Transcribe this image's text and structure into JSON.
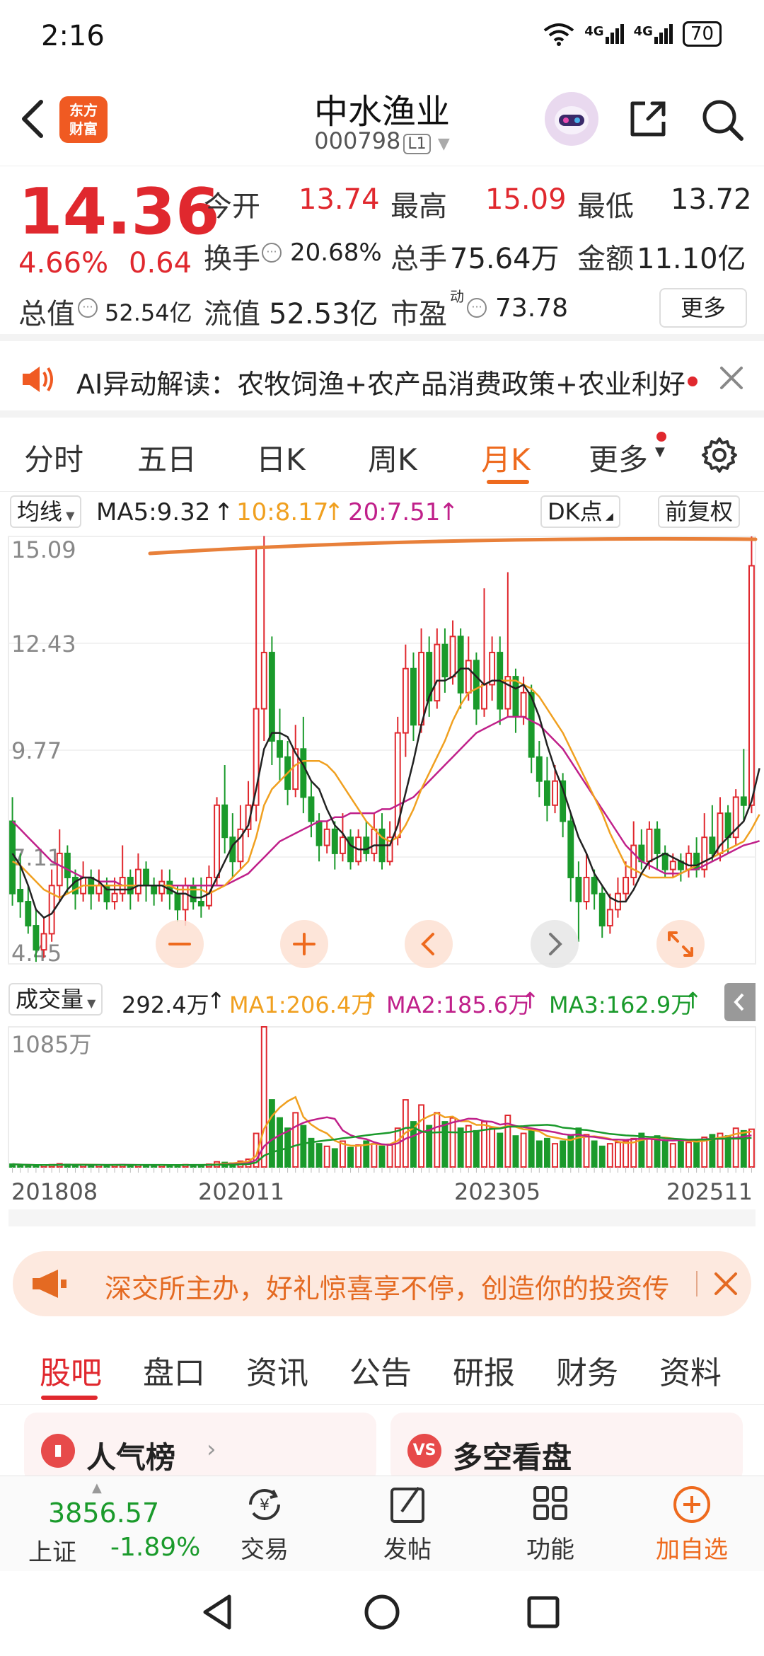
{
  "status_bar": {
    "time": "2:16",
    "network_1": "4G",
    "network_2": "4G",
    "battery": "70"
  },
  "header": {
    "name": "中水渔业",
    "code": "000798",
    "level_tag": "L1",
    "logo_text_1": "东方",
    "logo_text_2": "财富"
  },
  "quote": {
    "price": "14.36",
    "change_pct": "4.66%",
    "change_val": "0.64",
    "open_label": "今开",
    "open": "13.74",
    "high_label": "最高",
    "high": "15.09",
    "low_label": "最低",
    "low": "13.72",
    "turnover_label": "换手",
    "turnover": "20.68%",
    "volume_label": "总手",
    "volume": "75.64万",
    "amount_label": "金额",
    "amount": "11.10亿",
    "mktcap_label": "总值",
    "mktcap": "52.54亿",
    "float_label": "流值",
    "float_cap": "52.53亿",
    "pe_label": "市盈",
    "pe_sup": "动",
    "pe": "73.78",
    "more_button": "更多"
  },
  "ai_bar": {
    "text": "AI异动解读：农牧饲渔+农产品消费政策+农业利好"
  },
  "tabs": [
    "分时",
    "五日",
    "日K",
    "周K",
    "月K",
    "更多"
  ],
  "active_tab": "月K",
  "ma": {
    "selector": "均线",
    "ma5": "MA5:9.32",
    "ma10": "10:8.17",
    "ma20": "20:7.51",
    "dk_button": "DK点",
    "adjust_button": "前复权"
  },
  "chart_data": {
    "type": "candlestick",
    "period": "monthly",
    "y_ticks": [
      "15.09",
      "12.43",
      "9.77",
      "7.11",
      "4.45"
    ],
    "ylim": [
      4.45,
      15.09
    ],
    "x_labels": [
      "201808",
      "202011",
      "202305",
      "202511"
    ],
    "colors": {
      "up": "#e0282e",
      "down": "#1a9a2b",
      "ma5": "#222222",
      "ma10": "#f0a020",
      "ma20": "#c0208a"
    },
    "candles": [
      [
        8.0,
        6.2,
        8.6,
        5.9
      ],
      [
        6.3,
        6.0,
        7.2,
        5.6
      ],
      [
        6.0,
        5.4,
        6.4,
        5.2
      ],
      [
        5.4,
        4.8,
        5.8,
        4.5
      ],
      [
        4.8,
        5.2,
        5.6,
        4.6
      ],
      [
        5.2,
        6.4,
        6.8,
        5.0
      ],
      [
        6.4,
        7.2,
        7.8,
        6.0
      ],
      [
        7.2,
        6.6,
        7.4,
        6.2
      ],
      [
        6.6,
        6.2,
        6.8,
        5.8
      ],
      [
        6.2,
        6.6,
        7.0,
        6.0
      ],
      [
        6.6,
        6.2,
        6.8,
        5.8
      ],
      [
        6.2,
        6.4,
        6.8,
        6.0
      ],
      [
        6.4,
        6.0,
        6.6,
        5.8
      ],
      [
        6.0,
        6.2,
        6.6,
        5.8
      ],
      [
        6.2,
        6.6,
        7.4,
        6.0
      ],
      [
        6.6,
        6.2,
        6.8,
        5.8
      ],
      [
        6.2,
        6.8,
        7.2,
        6.0
      ],
      [
        6.8,
        6.4,
        7.0,
        6.0
      ],
      [
        6.4,
        6.2,
        6.6,
        5.9
      ],
      [
        6.2,
        6.5,
        6.8,
        6.0
      ],
      [
        6.5,
        6.2,
        6.8,
        5.8
      ],
      [
        6.2,
        5.8,
        6.4,
        5.5
      ],
      [
        5.8,
        6.4,
        6.6,
        5.4
      ],
      [
        6.4,
        6.0,
        6.6,
        5.8
      ],
      [
        6.0,
        5.9,
        6.6,
        5.6
      ],
      [
        5.9,
        6.6,
        6.9,
        5.8
      ],
      [
        6.6,
        8.4,
        8.6,
        6.4
      ],
      [
        8.4,
        7.6,
        9.4,
        7.2
      ],
      [
        7.6,
        7.0,
        8.2,
        6.6
      ],
      [
        7.0,
        7.8,
        8.4,
        6.8
      ],
      [
        7.8,
        8.4,
        9.0,
        7.6
      ],
      [
        8.4,
        10.8,
        14.8,
        8.0
      ],
      [
        10.8,
        12.2,
        15.1,
        10.0
      ],
      [
        12.2,
        10.0,
        12.6,
        9.4
      ],
      [
        10.0,
        9.6,
        10.8,
        9.0
      ],
      [
        9.6,
        8.8,
        10.0,
        8.4
      ],
      [
        8.8,
        9.8,
        10.4,
        8.6
      ],
      [
        9.8,
        8.6,
        10.6,
        8.2
      ],
      [
        8.6,
        8.0,
        9.0,
        7.6
      ],
      [
        8.0,
        7.4,
        8.2,
        7.0
      ],
      [
        7.4,
        7.8,
        8.0,
        7.2
      ],
      [
        7.8,
        7.2,
        8.0,
        6.8
      ],
      [
        7.2,
        7.6,
        8.2,
        7.0
      ],
      [
        7.6,
        7.0,
        7.8,
        6.8
      ],
      [
        7.0,
        7.6,
        7.8,
        6.9
      ],
      [
        7.6,
        7.2,
        8.0,
        7.0
      ],
      [
        7.2,
        7.8,
        8.2,
        7.0
      ],
      [
        7.8,
        7.0,
        8.2,
        6.8
      ],
      [
        7.0,
        7.6,
        8.0,
        6.9
      ],
      [
        7.6,
        10.2,
        10.6,
        7.4
      ],
      [
        10.2,
        11.8,
        12.4,
        9.6
      ],
      [
        11.8,
        10.4,
        12.2,
        10.0
      ],
      [
        10.4,
        12.2,
        12.8,
        10.2
      ],
      [
        12.2,
        11.0,
        12.6,
        10.6
      ],
      [
        11.0,
        12.4,
        12.8,
        10.8
      ],
      [
        12.4,
        11.6,
        12.8,
        11.2
      ],
      [
        11.6,
        12.6,
        13.0,
        11.4
      ],
      [
        12.6,
        11.2,
        12.8,
        10.8
      ],
      [
        11.2,
        12.0,
        12.6,
        11.0
      ],
      [
        12.0,
        10.8,
        12.2,
        10.4
      ],
      [
        10.8,
        11.4,
        13.8,
        10.6
      ],
      [
        11.4,
        12.2,
        12.6,
        11.0
      ],
      [
        12.2,
        10.8,
        12.6,
        10.4
      ],
      [
        10.8,
        11.6,
        14.2,
        10.6
      ],
      [
        11.6,
        10.6,
        11.8,
        10.2
      ],
      [
        10.6,
        11.2,
        11.6,
        10.4
      ],
      [
        11.2,
        9.6,
        11.4,
        9.2
      ],
      [
        9.6,
        9.0,
        10.0,
        8.6
      ],
      [
        9.0,
        8.4,
        9.6,
        8.0
      ],
      [
        8.4,
        9.0,
        9.4,
        8.2
      ],
      [
        9.0,
        8.0,
        9.2,
        7.6
      ],
      [
        8.0,
        6.6,
        8.2,
        6.0
      ],
      [
        6.6,
        6.0,
        7.0,
        5.0
      ],
      [
        6.0,
        6.6,
        7.2,
        5.8
      ],
      [
        6.6,
        6.2,
        6.8,
        5.8
      ],
      [
        6.2,
        5.4,
        6.4,
        5.1
      ],
      [
        5.4,
        5.8,
        6.2,
        5.2
      ],
      [
        5.8,
        6.2,
        6.6,
        5.6
      ],
      [
        6.2,
        6.6,
        7.0,
        6.0
      ],
      [
        6.6,
        7.4,
        8.0,
        6.4
      ],
      [
        7.4,
        7.0,
        7.8,
        6.8
      ],
      [
        7.0,
        7.8,
        8.0,
        6.8
      ],
      [
        7.8,
        7.2,
        8.0,
        6.8
      ],
      [
        7.2,
        6.8,
        7.4,
        6.6
      ],
      [
        6.8,
        7.0,
        7.2,
        6.6
      ],
      [
        7.0,
        6.8,
        7.2,
        6.5
      ],
      [
        6.8,
        7.2,
        7.4,
        6.6
      ],
      [
        7.2,
        6.8,
        7.6,
        6.6
      ],
      [
        6.8,
        7.6,
        8.2,
        6.6
      ],
      [
        7.6,
        7.2,
        8.4,
        7.0
      ],
      [
        7.2,
        8.2,
        8.6,
        7.0
      ],
      [
        8.2,
        7.6,
        8.4,
        7.2
      ],
      [
        7.6,
        8.6,
        8.8,
        7.4
      ],
      [
        8.6,
        8.4,
        9.8,
        8.0
      ],
      [
        8.4,
        14.36,
        15.09,
        8.2
      ]
    ],
    "ma5": [
      7.2,
      6.9,
      6.4,
      5.8,
      5.6,
      5.7,
      6.0,
      6.3,
      6.5,
      6.6,
      6.6,
      6.5,
      6.3,
      6.3,
      6.3,
      6.3,
      6.4,
      6.4,
      6.4,
      6.4,
      6.3,
      6.2,
      6.2,
      6.1,
      6.1,
      6.2,
      6.6,
      7.0,
      7.4,
      7.6,
      7.9,
      8.8,
      9.8,
      10.2,
      10.2,
      10.1,
      9.7,
      9.4,
      9.0,
      8.8,
      8.3,
      7.9,
      7.7,
      7.4,
      7.3,
      7.3,
      7.4,
      7.4,
      7.4,
      7.9,
      8.7,
      9.5,
      10.4,
      11.1,
      11.5,
      11.5,
      11.6,
      11.8,
      11.8,
      11.6,
      11.4,
      11.5,
      11.5,
      11.4,
      11.3,
      11.4,
      11.1,
      10.6,
      9.9,
      9.3,
      8.8,
      8.2,
      7.6,
      7.2,
      6.7,
      6.4,
      6.1,
      6.0,
      6.0,
      6.3,
      6.7,
      7.0,
      7.1,
      7.2,
      7.1,
      7.0,
      6.9,
      6.9,
      7.0,
      7.1,
      7.4,
      7.6,
      7.8,
      8.0,
      8.5,
      9.32
    ],
    "ma10": [
      7.0,
      6.9,
      6.7,
      6.5,
      6.3,
      6.2,
      6.1,
      6.2,
      6.3,
      6.4,
      6.4,
      6.4,
      6.4,
      6.4,
      6.4,
      6.4,
      6.4,
      6.4,
      6.4,
      6.4,
      6.4,
      6.3,
      6.3,
      6.3,
      6.3,
      6.2,
      6.3,
      6.4,
      6.6,
      6.8,
      7.0,
      7.6,
      8.4,
      8.8,
      9.0,
      9.2,
      9.4,
      9.5,
      9.5,
      9.5,
      9.4,
      9.2,
      8.9,
      8.6,
      8.3,
      8.0,
      7.8,
      7.6,
      7.5,
      7.6,
      7.9,
      8.3,
      8.8,
      9.2,
      9.6,
      10.0,
      10.5,
      10.9,
      11.2,
      11.3,
      11.4,
      11.5,
      11.5,
      11.5,
      11.5,
      11.4,
      11.3,
      11.1,
      10.8,
      10.5,
      10.2,
      9.8,
      9.4,
      9.0,
      8.6,
      8.2,
      7.7,
      7.3,
      6.9,
      6.8,
      6.7,
      6.6,
      6.6,
      6.6,
      6.6,
      6.7,
      6.8,
      6.9,
      7.0,
      7.1,
      7.2,
      7.3,
      7.4,
      7.5,
      7.8,
      8.17
    ],
    "ma20": [
      8.0,
      7.8,
      7.6,
      7.4,
      7.2,
      7.0,
      6.9,
      6.8,
      6.7,
      6.6,
      6.6,
      6.5,
      6.5,
      6.5,
      6.4,
      6.4,
      6.4,
      6.4,
      6.4,
      6.4,
      6.4,
      6.4,
      6.4,
      6.4,
      6.4,
      6.4,
      6.4,
      6.4,
      6.5,
      6.6,
      6.7,
      6.9,
      7.1,
      7.3,
      7.5,
      7.6,
      7.7,
      7.8,
      7.9,
      8.0,
      8.0,
      8.1,
      8.1,
      8.2,
      8.2,
      8.2,
      8.2,
      8.3,
      8.3,
      8.4,
      8.5,
      8.6,
      8.8,
      9.0,
      9.2,
      9.4,
      9.6,
      9.8,
      10.0,
      10.2,
      10.3,
      10.4,
      10.5,
      10.6,
      10.6,
      10.6,
      10.5,
      10.4,
      10.2,
      10.0,
      9.8,
      9.5,
      9.2,
      8.9,
      8.6,
      8.3,
      8.0,
      7.7,
      7.4,
      7.2,
      7.0,
      6.9,
      6.8,
      6.7,
      6.7,
      6.7,
      6.8,
      6.8,
      6.9,
      7.0,
      7.1,
      7.2,
      7.3,
      7.4,
      7.45,
      7.51
    ]
  },
  "volume_panel": {
    "selector": "成交量",
    "current": "292.4万",
    "ma1": "MA1:206.4万",
    "ma2": "MA2:185.6万",
    "ma3": "MA3:162.9万",
    "y_max_label": "1085万",
    "values": [
      22,
      15,
      12,
      10,
      14,
      18,
      25,
      20,
      15,
      16,
      14,
      15,
      13,
      14,
      18,
      14,
      16,
      15,
      13,
      14,
      15,
      14,
      18,
      14,
      16,
      22,
      40,
      35,
      30,
      45,
      60,
      260,
      1085,
      520,
      380,
      300,
      420,
      320,
      220,
      180,
      160,
      140,
      200,
      150,
      170,
      200,
      180,
      160,
      170,
      300,
      520,
      350,
      480,
      320,
      420,
      350,
      380,
      300,
      320,
      280,
      350,
      300,
      260,
      400,
      240,
      260,
      280,
      200,
      220,
      180,
      200,
      240,
      300,
      250,
      200,
      160,
      180,
      190,
      200,
      220,
      260,
      220,
      240,
      200,
      180,
      200,
      190,
      210,
      230,
      250,
      260,
      240,
      300,
      280,
      292.4
    ]
  },
  "chart_controls": {
    "plus": "+",
    "prev": "‹",
    "next": "›"
  },
  "promo": {
    "text": "深交所主办，好礼惊喜享不停，创造你的投资传"
  },
  "content_tabs": [
    "股吧",
    "盘口",
    "资讯",
    "公告",
    "研报",
    "财务",
    "资料"
  ],
  "active_content_tab": "股吧",
  "cards": {
    "popularity": "人气榜",
    "bull_bear": "多空看盘",
    "vs_icon_text": "VS"
  },
  "bottom_nav": {
    "index_value": "3856.57",
    "index_name": "上证",
    "index_change": "-1.89%",
    "trade": "交易",
    "post": "发帖",
    "features": "功能",
    "add_watch": "加自选"
  }
}
